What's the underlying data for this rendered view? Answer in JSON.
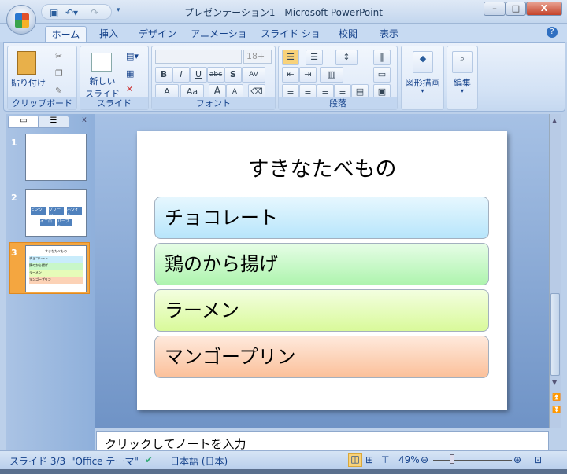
{
  "window": {
    "title": "プレゼンテーション1 - Microsoft PowerPoint",
    "minimize": "–",
    "maximize": "□",
    "close": "X"
  },
  "tabs": [
    {
      "label": "ホーム",
      "active": true
    },
    {
      "label": "挿入"
    },
    {
      "label": "デザイン"
    },
    {
      "label": "アニメーション"
    },
    {
      "label": "スライド ショー"
    },
    {
      "label": "校閲"
    },
    {
      "label": "表示"
    }
  ],
  "help": "?",
  "ribbon": {
    "clipboard": {
      "label": "クリップボード",
      "paste": "貼り付け"
    },
    "slides": {
      "label": "スライド",
      "new_slide_1": "新しい",
      "new_slide_2": "スライド ▾"
    },
    "font": {
      "label": "フォント",
      "font_size": "18+",
      "bold": "B",
      "italic": "I",
      "underline": "U",
      "strike": "abc",
      "shadow": "S",
      "spacing": "AV",
      "color": "A",
      "case": "Aa",
      "grow": "A",
      "shrink": "A"
    },
    "paragraph": {
      "label": "段落"
    },
    "drawing": {
      "label": "図形描画"
    },
    "editing": {
      "label": "編集"
    }
  },
  "thumbnails": [
    {
      "num": "1",
      "labels": []
    },
    {
      "num": "2",
      "labels": [
        "ピンク",
        "グリーン",
        "ホワイト",
        "イエロー",
        "パープル"
      ]
    },
    {
      "num": "3",
      "selected": true
    }
  ],
  "slide": {
    "title": "すきなたべもの",
    "items": [
      {
        "text": "チョコレート",
        "color": "#c9ecfb"
      },
      {
        "text": "鶏のから揚げ",
        "color": "#c8f7c8"
      },
      {
        "text": "ラーメン",
        "color": "#e6fbb8"
      },
      {
        "text": "マンゴープリン",
        "color": "#fcd2b6"
      }
    ]
  },
  "notes": {
    "placeholder": "クリックしてノートを入力"
  },
  "status": {
    "slide": "スライド 3/3",
    "theme": "\"Office テーマ\"",
    "language": "日本語 (日本)",
    "zoom": "49%",
    "zoom_percent": 49
  }
}
